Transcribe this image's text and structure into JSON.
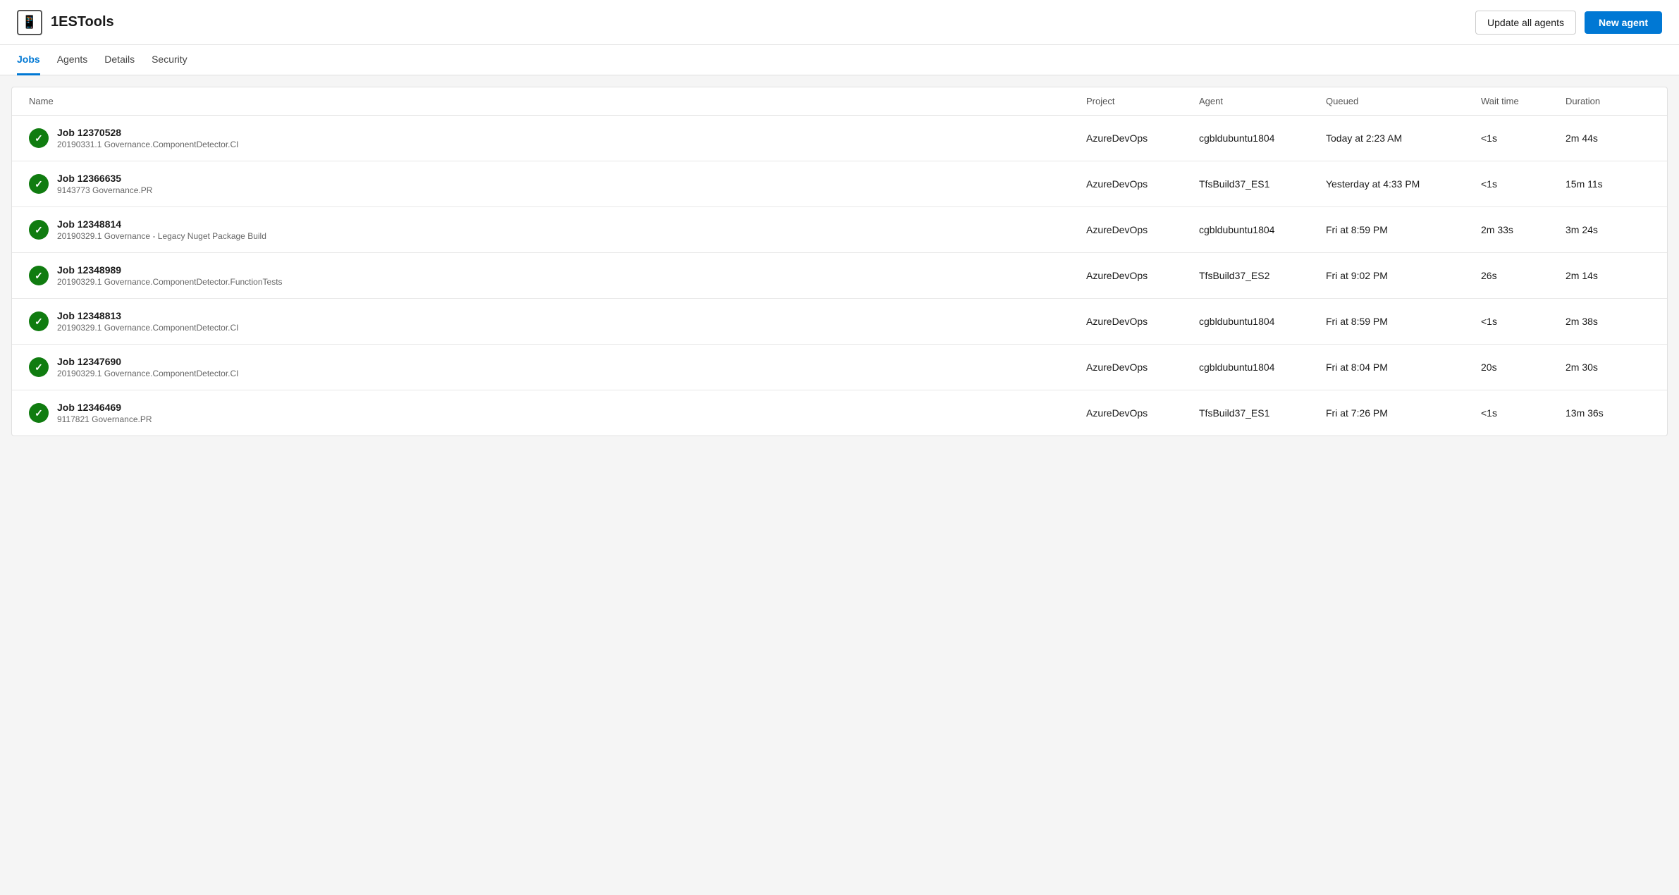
{
  "app": {
    "title": "1ESTools",
    "icon": "📱"
  },
  "header": {
    "update_all_agents_label": "Update all agents",
    "new_agent_label": "New agent"
  },
  "tabs": [
    {
      "id": "jobs",
      "label": "Jobs",
      "active": true
    },
    {
      "id": "agents",
      "label": "Agents",
      "active": false
    },
    {
      "id": "details",
      "label": "Details",
      "active": false
    },
    {
      "id": "security",
      "label": "Security",
      "active": false
    }
  ],
  "table": {
    "columns": [
      "Name",
      "Project",
      "Agent",
      "Queued",
      "Wait time",
      "Duration"
    ],
    "rows": [
      {
        "job_name": "Job 12370528",
        "job_meta": "20190331.1   Governance.ComponentDetector.CI",
        "project": "AzureDevOps",
        "agent": "cgbldubuntu1804",
        "queued": "Today at 2:23 AM",
        "wait_time": "<1s",
        "duration": "2m 44s",
        "status": "success"
      },
      {
        "job_name": "Job 12366635",
        "job_meta": "9143773   Governance.PR",
        "project": "AzureDevOps",
        "agent": "TfsBuild37_ES1",
        "queued": "Yesterday at 4:33 PM",
        "wait_time": "<1s",
        "duration": "15m 11s",
        "status": "success"
      },
      {
        "job_name": "Job 12348814",
        "job_meta": "20190329.1   Governance - Legacy Nuget Package Build",
        "project": "AzureDevOps",
        "agent": "cgbldubuntu1804",
        "queued": "Fri at 8:59 PM",
        "wait_time": "2m 33s",
        "duration": "3m 24s",
        "status": "success"
      },
      {
        "job_name": "Job 12348989",
        "job_meta": "20190329.1   Governance.ComponentDetector.FunctionTests",
        "project": "AzureDevOps",
        "agent": "TfsBuild37_ES2",
        "queued": "Fri at 9:02 PM",
        "wait_time": "26s",
        "duration": "2m 14s",
        "status": "success"
      },
      {
        "job_name": "Job 12348813",
        "job_meta": "20190329.1   Governance.ComponentDetector.CI",
        "project": "AzureDevOps",
        "agent": "cgbldubuntu1804",
        "queued": "Fri at 8:59 PM",
        "wait_time": "<1s",
        "duration": "2m 38s",
        "status": "success"
      },
      {
        "job_name": "Job 12347690",
        "job_meta": "20190329.1   Governance.ComponentDetector.CI",
        "project": "AzureDevOps",
        "agent": "cgbldubuntu1804",
        "queued": "Fri at 8:04 PM",
        "wait_time": "20s",
        "duration": "2m 30s",
        "status": "success"
      },
      {
        "job_name": "Job 12346469",
        "job_meta": "9117821   Governance.PR",
        "project": "AzureDevOps",
        "agent": "TfsBuild37_ES1",
        "queued": "Fri at 7:26 PM",
        "wait_time": "<1s",
        "duration": "13m 36s",
        "status": "success"
      }
    ]
  }
}
